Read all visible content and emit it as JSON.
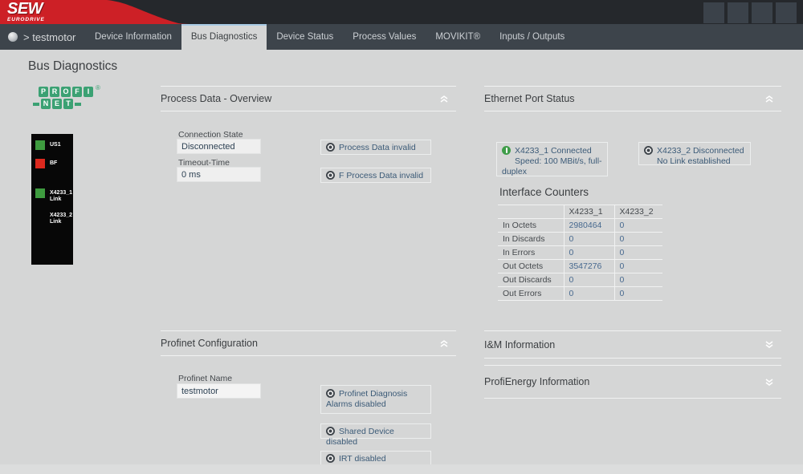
{
  "header": {
    "brand": "SEW",
    "brand_sub": "EURODRIVE",
    "buttons": [
      "",
      "",
      "",
      ""
    ]
  },
  "nav": {
    "breadcrumb": "> testmotor",
    "tabs": [
      {
        "label": "Device Information",
        "active": false
      },
      {
        "label": "Bus Diagnostics",
        "active": true
      },
      {
        "label": "Device Status",
        "active": false
      },
      {
        "label": "Process Values",
        "active": false
      },
      {
        "label": "MOVIKIT®",
        "active": false
      },
      {
        "label": "Inputs / Outputs",
        "active": false
      }
    ]
  },
  "page": {
    "title": "Bus Diagnostics"
  },
  "profinet_logo": {
    "row1": [
      "P",
      "R",
      "O",
      "F",
      "I"
    ],
    "row2": [
      "N",
      "E",
      "T"
    ],
    "registered": "®"
  },
  "led_panel": {
    "items": [
      {
        "label1": "US1",
        "label2": "",
        "led": "green"
      },
      {
        "label1": "BF",
        "label2": "",
        "led": "red"
      },
      {
        "label1": "X4233_1",
        "label2": "Link",
        "led": "green"
      },
      {
        "label1": "X4233_2",
        "label2": "Link",
        "led": "none"
      }
    ]
  },
  "process_data": {
    "title": "Process Data - Overview",
    "expanded": true,
    "fields": [
      {
        "label": "Connection State",
        "value": "Disconnected"
      },
      {
        "label": "Timeout-Time",
        "value": "0 ms"
      }
    ],
    "statuses": [
      {
        "text": "Process Data invalid"
      },
      {
        "text": "F Process Data invalid"
      }
    ]
  },
  "ethernet": {
    "title": "Ethernet Port Status",
    "expanded": true,
    "ports": [
      {
        "line1": "X4233_1 Connected",
        "line2": "Speed: 100 MBit/s, full-duplex",
        "state": "connected"
      },
      {
        "line1": "X4233_2 Disconnected",
        "line2": "No Link established",
        "state": "disconnected"
      }
    ],
    "counters": {
      "title": "Interface Counters",
      "columns": [
        "X4233_1",
        "X4233_2"
      ],
      "rows": [
        {
          "label": "In Octets",
          "values": [
            "2980464",
            "0"
          ]
        },
        {
          "label": "In Discards",
          "values": [
            "0",
            "0"
          ]
        },
        {
          "label": "In Errors",
          "values": [
            "0",
            "0"
          ]
        },
        {
          "label": "Out Octets",
          "values": [
            "3547276",
            "0"
          ]
        },
        {
          "label": "Out Discards",
          "values": [
            "0",
            "0"
          ]
        },
        {
          "label": "Out Errors",
          "values": [
            "0",
            "0"
          ]
        }
      ]
    }
  },
  "profinet_config": {
    "title": "Profinet Configuration",
    "expanded": true,
    "fields": [
      {
        "label": "Profinet Name",
        "value": "testmotor"
      }
    ],
    "statuses": [
      {
        "text": "Profinet Diagnosis Alarms disabled"
      },
      {
        "text": "Shared Device disabled"
      },
      {
        "text": "IRT disabled"
      }
    ]
  },
  "im_info": {
    "title": "I&M Information",
    "expanded": false
  },
  "profienergy": {
    "title": "ProfiEnergy Information",
    "expanded": false
  },
  "colors": {
    "brand_red": "#cd2026",
    "topbar": "#25282c",
    "navbar": "#3d444b",
    "active_tab_accent": "#a7c9e4",
    "profinet_green": "#3ba173",
    "led_green": "#3e9b3f",
    "led_red": "#dc291e",
    "status_icon_green": "#3f9d49",
    "status_icon_dark": "#41474d",
    "counter_value_blue": "#47698f"
  }
}
